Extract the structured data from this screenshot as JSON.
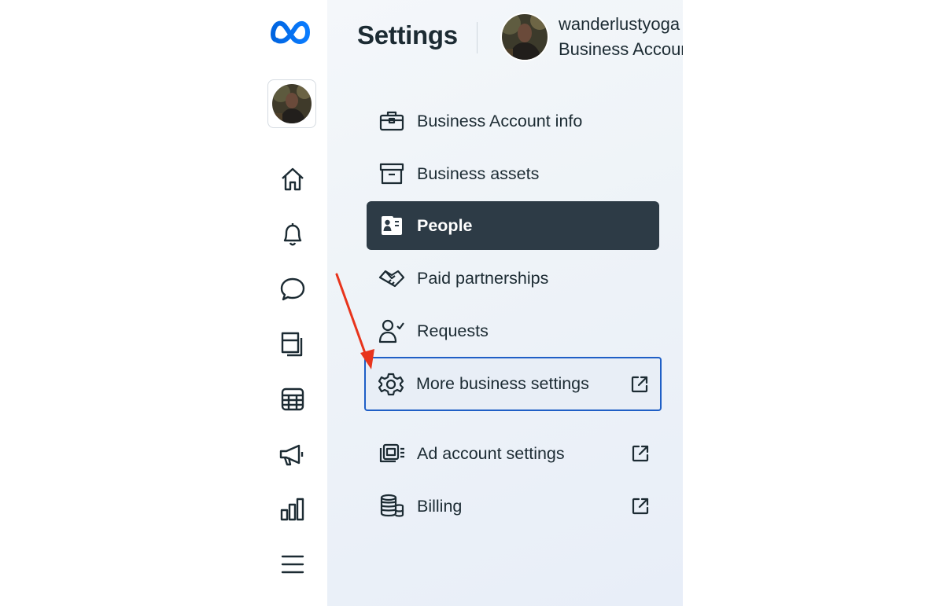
{
  "header": {
    "title": "Settings",
    "account_name": "wanderlustyoga",
    "account_type": "Business Account"
  },
  "rail": {
    "items": [
      {
        "name": "meta-logo",
        "icon": "meta-infinity-logo"
      },
      {
        "name": "account-switcher",
        "icon": "avatar"
      },
      {
        "name": "home",
        "icon": "home-icon"
      },
      {
        "name": "notifications",
        "icon": "bell-icon"
      },
      {
        "name": "messages",
        "icon": "chat-bubble-icon"
      },
      {
        "name": "content",
        "icon": "content-pages-icon"
      },
      {
        "name": "planner",
        "icon": "calendar-grid-icon"
      },
      {
        "name": "ads",
        "icon": "megaphone-icon"
      },
      {
        "name": "insights",
        "icon": "bar-chart-icon"
      },
      {
        "name": "menu",
        "icon": "hamburger-icon"
      }
    ]
  },
  "menu": {
    "items": [
      {
        "label": "Business Account info",
        "icon": "briefcase-icon",
        "external": false,
        "state": "normal"
      },
      {
        "label": "Business assets",
        "icon": "archive-box-icon",
        "external": false,
        "state": "normal"
      },
      {
        "label": "People",
        "icon": "people-badge-icon",
        "external": false,
        "state": "selected"
      },
      {
        "label": "Paid partnerships",
        "icon": "handshake-icon",
        "external": false,
        "state": "normal"
      },
      {
        "label": "Requests",
        "icon": "person-check-icon",
        "external": false,
        "state": "normal"
      },
      {
        "label": "More business settings",
        "icon": "gear-icon",
        "external": true,
        "state": "focused"
      },
      {
        "label": "Ad account settings",
        "icon": "ad-account-icon",
        "external": true,
        "state": "normal"
      },
      {
        "label": "Billing",
        "icon": "coins-icon",
        "external": true,
        "state": "normal"
      }
    ]
  },
  "colors": {
    "brand_blue": "#0668e1",
    "selected_bg": "#2d3b46",
    "focus_border": "#1f5fc6",
    "annotation_arrow": "#e8341c",
    "text": "#1c2b33"
  }
}
